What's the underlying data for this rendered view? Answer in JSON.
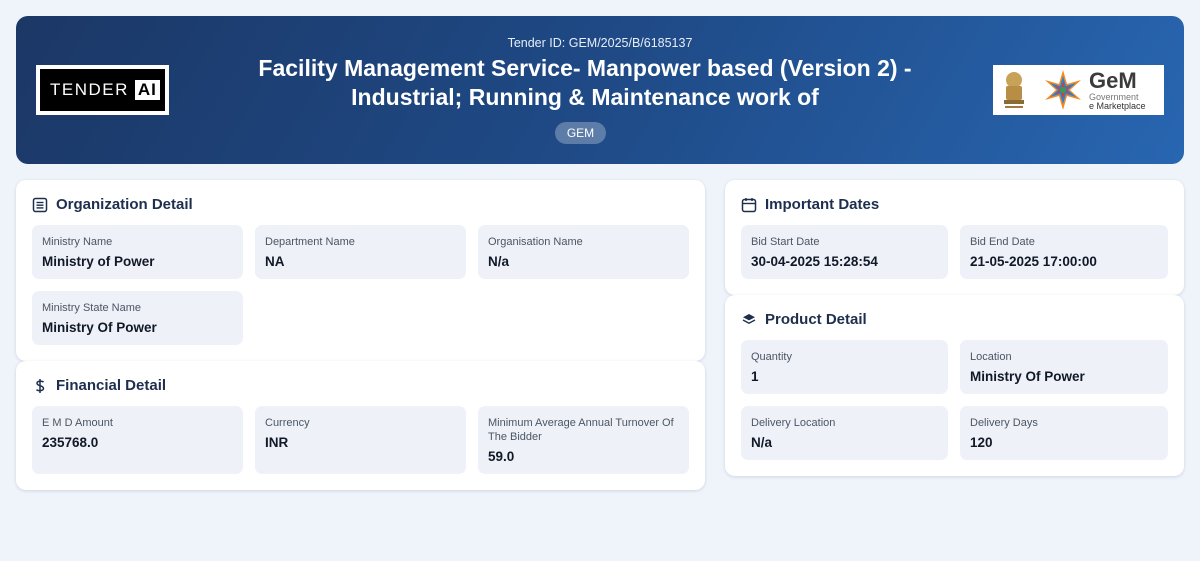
{
  "header": {
    "tender_id": "Tender ID: GEM/2025/B/6185137",
    "title": "Facility Management Service- Manpower based (Version 2) - Industrial; Running & Maintenance work of",
    "badge": "GEM",
    "logo_left": {
      "text1": "TENDER",
      "text2": "AI"
    },
    "logo_right": {
      "text1": "GeM",
      "text2": "Government",
      "text3": "e Marketplace",
      "emblem_icon": "national-emblem-icon",
      "star_icon": "gem-star-icon"
    }
  },
  "organization": {
    "title": "Organization Detail",
    "icon": "document-list-icon",
    "fields": [
      {
        "label": "Ministry Name",
        "value": "Ministry of Power"
      },
      {
        "label": "Department Name",
        "value": "NA"
      },
      {
        "label": "Organisation Name",
        "value": "N/a"
      },
      {
        "label": "Ministry State Name",
        "value": "Ministry Of Power"
      }
    ]
  },
  "financial": {
    "title": "Financial Detail",
    "icon": "dollar-icon",
    "fields": [
      {
        "label": "E M D Amount",
        "value": "235768.0"
      },
      {
        "label": "Currency",
        "value": "INR"
      },
      {
        "label": "Minimum Average Annual Turnover Of The Bidder",
        "value": "59.0"
      }
    ]
  },
  "dates": {
    "title": "Important Dates",
    "icon": "calendar-icon",
    "fields": [
      {
        "label": "Bid Start Date",
        "value": "30-04-2025 15:28:54"
      },
      {
        "label": "Bid End Date",
        "value": "21-05-2025 17:00:00"
      }
    ]
  },
  "product": {
    "title": "Product Detail",
    "icon": "layers-icon",
    "fields": [
      {
        "label": "Quantity",
        "value": "1"
      },
      {
        "label": "Location",
        "value": "Ministry Of Power"
      },
      {
        "label": "Delivery Location",
        "value": "N/a"
      },
      {
        "label": "Delivery Days",
        "value": "120"
      }
    ]
  },
  "colors": {
    "header_gradient_start": "#1b3766",
    "header_gradient_end": "#2866b1",
    "page_background": "#eff3fa",
    "field_background": "#eef2f8"
  }
}
